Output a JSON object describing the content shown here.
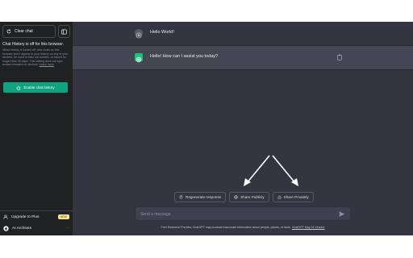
{
  "sidebar": {
    "clear_chat": "Clear chat",
    "history_title": "Chat History is off for this browser.",
    "history_text": "When history is turned off, new chats on this browser won't appear in your history on any of your devices, be used to train our models, or stored for longer than 30 days. This setting does not sync across browsers or devices.",
    "learn_more": "Learn more",
    "enable_button": "Enable chat history",
    "upgrade_label": "Upgrade to Plus",
    "new_badge": "NEW",
    "account_name": "AI Archives"
  },
  "conversation": {
    "user_message": "Hello World!",
    "assistant_message": "Hello! How can I assist you today?"
  },
  "actions": {
    "regenerate": "Regenerate response",
    "share_publicly": "Share Publicly",
    "share_privately": "Share Privately"
  },
  "composer": {
    "placeholder": "Send a message"
  },
  "footer": {
    "note": "Free Research Preview. ChatGPT may produce inaccurate information about people, places, or facts.",
    "version_link": "ChatGPT May 24 Version"
  },
  "colors": {
    "accent": "#10a37f",
    "sidebar_bg": "#202123",
    "main_bg": "#343541",
    "assistant_row_bg": "#444654",
    "badge_bg": "#fae69e"
  }
}
